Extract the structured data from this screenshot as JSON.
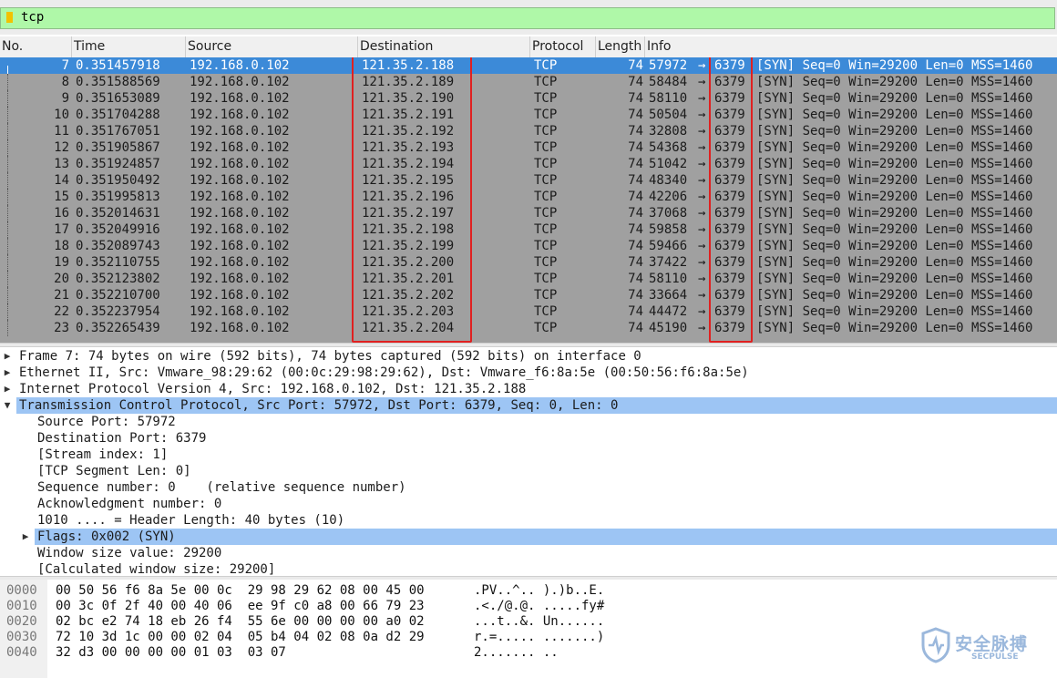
{
  "filter": {
    "text": "tcp",
    "bg_color": "#aff8a8"
  },
  "columns": [
    "No.",
    "Time",
    "Source",
    "Destination",
    "Protocol",
    "Length",
    "Info"
  ],
  "packets": [
    {
      "no": "7",
      "time": "0.351457918",
      "src": "192.168.0.102",
      "dst": "121.35.2.188",
      "proto": "TCP",
      "len": "74",
      "sport": "57972",
      "dport": "6379",
      "rest": "[SYN] Seq=0 Win=29200 Len=0 MSS=1460"
    },
    {
      "no": "8",
      "time": "0.351588569",
      "src": "192.168.0.102",
      "dst": "121.35.2.189",
      "proto": "TCP",
      "len": "74",
      "sport": "58484",
      "dport": "6379",
      "rest": "[SYN] Seq=0 Win=29200 Len=0 MSS=1460"
    },
    {
      "no": "9",
      "time": "0.351653089",
      "src": "192.168.0.102",
      "dst": "121.35.2.190",
      "proto": "TCP",
      "len": "74",
      "sport": "58110",
      "dport": "6379",
      "rest": "[SYN] Seq=0 Win=29200 Len=0 MSS=1460"
    },
    {
      "no": "10",
      "time": "0.351704288",
      "src": "192.168.0.102",
      "dst": "121.35.2.191",
      "proto": "TCP",
      "len": "74",
      "sport": "50504",
      "dport": "6379",
      "rest": "[SYN] Seq=0 Win=29200 Len=0 MSS=1460"
    },
    {
      "no": "11",
      "time": "0.351767051",
      "src": "192.168.0.102",
      "dst": "121.35.2.192",
      "proto": "TCP",
      "len": "74",
      "sport": "32808",
      "dport": "6379",
      "rest": "[SYN] Seq=0 Win=29200 Len=0 MSS=1460"
    },
    {
      "no": "12",
      "time": "0.351905867",
      "src": "192.168.0.102",
      "dst": "121.35.2.193",
      "proto": "TCP",
      "len": "74",
      "sport": "54368",
      "dport": "6379",
      "rest": "[SYN] Seq=0 Win=29200 Len=0 MSS=1460"
    },
    {
      "no": "13",
      "time": "0.351924857",
      "src": "192.168.0.102",
      "dst": "121.35.2.194",
      "proto": "TCP",
      "len": "74",
      "sport": "51042",
      "dport": "6379",
      "rest": "[SYN] Seq=0 Win=29200 Len=0 MSS=1460"
    },
    {
      "no": "14",
      "time": "0.351950492",
      "src": "192.168.0.102",
      "dst": "121.35.2.195",
      "proto": "TCP",
      "len": "74",
      "sport": "48340",
      "dport": "6379",
      "rest": "[SYN] Seq=0 Win=29200 Len=0 MSS=1460"
    },
    {
      "no": "15",
      "time": "0.351995813",
      "src": "192.168.0.102",
      "dst": "121.35.2.196",
      "proto": "TCP",
      "len": "74",
      "sport": "42206",
      "dport": "6379",
      "rest": "[SYN] Seq=0 Win=29200 Len=0 MSS=1460"
    },
    {
      "no": "16",
      "time": "0.352014631",
      "src": "192.168.0.102",
      "dst": "121.35.2.197",
      "proto": "TCP",
      "len": "74",
      "sport": "37068",
      "dport": "6379",
      "rest": "[SYN] Seq=0 Win=29200 Len=0 MSS=1460"
    },
    {
      "no": "17",
      "time": "0.352049916",
      "src": "192.168.0.102",
      "dst": "121.35.2.198",
      "proto": "TCP",
      "len": "74",
      "sport": "59858",
      "dport": "6379",
      "rest": "[SYN] Seq=0 Win=29200 Len=0 MSS=1460"
    },
    {
      "no": "18",
      "time": "0.352089743",
      "src": "192.168.0.102",
      "dst": "121.35.2.199",
      "proto": "TCP",
      "len": "74",
      "sport": "59466",
      "dport": "6379",
      "rest": "[SYN] Seq=0 Win=29200 Len=0 MSS=1460"
    },
    {
      "no": "19",
      "time": "0.352110755",
      "src": "192.168.0.102",
      "dst": "121.35.2.200",
      "proto": "TCP",
      "len": "74",
      "sport": "37422",
      "dport": "6379",
      "rest": "[SYN] Seq=0 Win=29200 Len=0 MSS=1460"
    },
    {
      "no": "20",
      "time": "0.352123802",
      "src": "192.168.0.102",
      "dst": "121.35.2.201",
      "proto": "TCP",
      "len": "74",
      "sport": "58110",
      "dport": "6379",
      "rest": "[SYN] Seq=0 Win=29200 Len=0 MSS=1460"
    },
    {
      "no": "21",
      "time": "0.352210700",
      "src": "192.168.0.102",
      "dst": "121.35.2.202",
      "proto": "TCP",
      "len": "74",
      "sport": "33664",
      "dport": "6379",
      "rest": "[SYN] Seq=0 Win=29200 Len=0 MSS=1460"
    },
    {
      "no": "22",
      "time": "0.352237954",
      "src": "192.168.0.102",
      "dst": "121.35.2.203",
      "proto": "TCP",
      "len": "74",
      "sport": "44472",
      "dport": "6379",
      "rest": "[SYN] Seq=0 Win=29200 Len=0 MSS=1460"
    },
    {
      "no": "23",
      "time": "0.352265439",
      "src": "192.168.0.102",
      "dst": "121.35.2.204",
      "proto": "TCP",
      "len": "74",
      "sport": "45190",
      "dport": "6379",
      "rest": "[SYN] Seq=0 Win=29200 Len=0 MSS=1460"
    }
  ],
  "arrow_char": "→",
  "details": [
    {
      "text": "Frame 7: 74 bytes on wire (592 bits), 74 bytes captured (592 bits) on interface 0",
      "expander": "collapsed"
    },
    {
      "text": "Ethernet II, Src: Vmware_98:29:62 (00:0c:29:98:29:62), Dst: Vmware_f6:8a:5e (00:50:56:f6:8a:5e)",
      "expander": "collapsed"
    },
    {
      "text": "Internet Protocol Version 4, Src: 192.168.0.102, Dst: 121.35.2.188",
      "expander": "collapsed"
    },
    {
      "text": "Transmission Control Protocol, Src Port: 57972, Dst Port: 6379, Seq: 0, Len: 0",
      "expander": "expanded",
      "selected": true
    },
    {
      "text": "Source Port: 57972",
      "indent": 1
    },
    {
      "text": "Destination Port: 6379",
      "indent": 1
    },
    {
      "text": "[Stream index: 1]",
      "indent": 1
    },
    {
      "text": "[TCP Segment Len: 0]",
      "indent": 1
    },
    {
      "text": "Sequence number: 0    (relative sequence number)",
      "indent": 1
    },
    {
      "text": "Acknowledgment number: 0",
      "indent": 1
    },
    {
      "text": "1010 .... = Header Length: 40 bytes (10)",
      "indent": 1
    },
    {
      "text": "Flags: 0x002 (SYN)",
      "indent": 1,
      "expander": "collapsed",
      "selected": true
    },
    {
      "text": "Window size value: 29200",
      "indent": 1
    },
    {
      "text": "[Calculated window size: 29200]",
      "indent": 1
    }
  ],
  "bytes": [
    {
      "off": "0000",
      "hex": "00 50 56 f6 8a 5e 00 0c  29 98 29 62 08 00 45 00",
      "ascii": ".PV..^.. ).)b..E."
    },
    {
      "off": "0010",
      "hex": "00 3c 0f 2f 40 00 40 06  ee 9f c0 a8 00 66 79 23",
      "ascii": ".<./@.@. .....fy#"
    },
    {
      "off": "0020",
      "hex": "02 bc e2 74 18 eb 26 f4  55 6e 00 00 00 00 a0 02",
      "ascii": "...t..&. Un......"
    },
    {
      "off": "0030",
      "hex": "72 10 3d 1c 00 00 02 04  05 b4 04 02 08 0a d2 29",
      "ascii": "r.=..... .......)"
    },
    {
      "off": "0040",
      "hex": "32 d3 00 00 00 00 01 03  03 07",
      "ascii": "2....... .."
    }
  ],
  "watermark": {
    "title": "安全脉搏",
    "subtitle": "SECPULSE"
  },
  "colors": {
    "selected_row": "#3c8ad8",
    "list_bg": "#a0a0a0",
    "detail_selected": "#9dc5f4",
    "highlight_box": "#e02020"
  }
}
